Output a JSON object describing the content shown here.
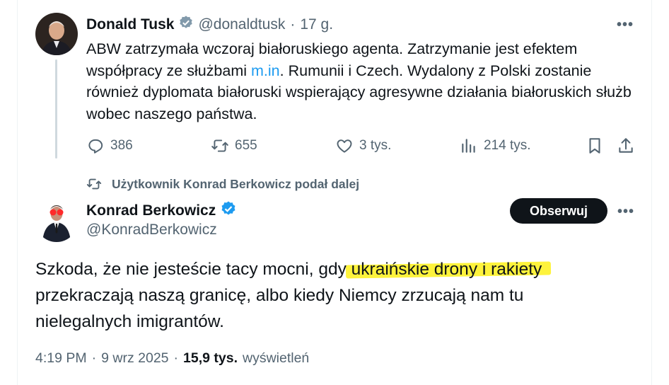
{
  "tweet1": {
    "author_name": "Donald Tusk",
    "handle": "@donaldtusk",
    "separator": "·",
    "time": "17 g.",
    "more_label": "•••",
    "text_before_link": "ABW zatrzymała wczoraj białoruskiego agenta. Zatrzymanie jest efektem współpracy ze służbami ",
    "link_text": "m.in",
    "text_after_link": ". Rumunii i Czech. Wydalony z Polski zostanie również dyplomata białoruski wspierający agresywne działania białoruskich służb wobec naszego państwa.",
    "stats": {
      "replies": "386",
      "reposts": "655",
      "likes": "3 tys.",
      "views": "214 tys."
    }
  },
  "retweet_note": "Użytkownik Konrad Berkowicz podał dalej",
  "tweet2": {
    "author_name": "Konrad Berkowicz",
    "handle": "@KonradBerkowicz",
    "follow_label": "Obserwuj",
    "more_label": "•••",
    "text_before_highlight": "Szkoda, że nie jesteście tacy mocni, gdy ",
    "highlight_text": "ukraińskie drony i rakiety",
    "text_after_highlight": " przekraczają naszą granicę, albo kiedy Niemcy zrzucają nam tu nielegalnych imigrantów.",
    "time": "4:19 PM",
    "date": "9 wrz 2025",
    "views_count": "15,9 tys.",
    "views_label": "wyświetleń",
    "separator": "·"
  },
  "colors": {
    "text": "#0f1419",
    "secondary": "#536471",
    "link": "#1d9bf0",
    "verified": "#1d9bf0",
    "highlight": "#fef11a",
    "follow_button": "#0f1419"
  },
  "icons": [
    "verified-badge-icon",
    "reply-icon",
    "repost-icon",
    "like-icon",
    "views-icon",
    "bookmark-icon",
    "share-icon",
    "more-icon"
  ]
}
